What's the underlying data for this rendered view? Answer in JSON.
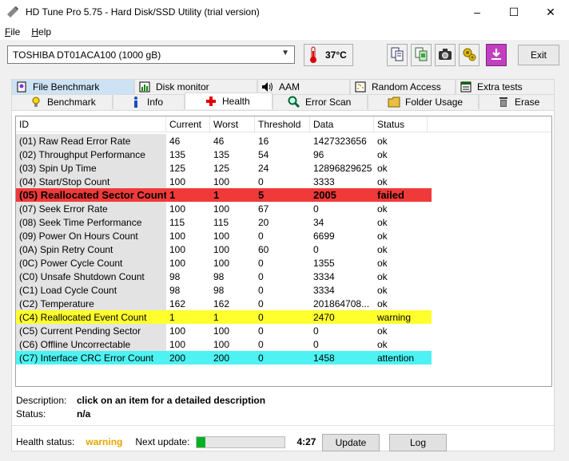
{
  "window": {
    "title": "HD Tune Pro 5.75 - Hard Disk/SSD Utility (trial version)",
    "minimize": "–",
    "maximize": "☐",
    "close": "✕"
  },
  "menu": [
    {
      "accel": "F",
      "rest": "ile"
    },
    {
      "accel": "H",
      "rest": "elp"
    }
  ],
  "toolbar": {
    "drive": "TOSHIBA DT01ACA100 (1000 gB)",
    "temperature": "37°C",
    "exit_label": "Exit",
    "icons": [
      "copy-text-icon",
      "copy-screen-icon",
      "camera-icon",
      "options-icon",
      "save-icon"
    ]
  },
  "tabs_row1": [
    {
      "label": "File Benchmark",
      "icon": "file-benchmark-icon"
    },
    {
      "label": "Disk monitor",
      "icon": "disk-monitor-icon"
    },
    {
      "label": "AAM",
      "icon": "speaker-icon"
    },
    {
      "label": "Random Access",
      "icon": "random-access-icon"
    },
    {
      "label": "Extra tests",
      "icon": "extra-tests-icon"
    }
  ],
  "tabs_row2": [
    {
      "label": "Benchmark",
      "icon": "benchmark-icon"
    },
    {
      "label": "Info",
      "icon": "info-icon"
    },
    {
      "label": "Health",
      "icon": "health-icon"
    },
    {
      "label": "Error Scan",
      "icon": "error-scan-icon"
    },
    {
      "label": "Folder Usage",
      "icon": "folder-icon"
    },
    {
      "label": "Erase",
      "icon": "erase-icon"
    }
  ],
  "table": {
    "headers": [
      "ID",
      "Current",
      "Worst",
      "Threshold",
      "Data",
      "Status"
    ],
    "rows": [
      {
        "id": "(01) Raw Read Error Rate",
        "current": "46",
        "worst": "46",
        "threshold": "16",
        "data": "1427323656",
        "status": "ok",
        "kind": "normal"
      },
      {
        "id": "(02) Throughput Performance",
        "current": "135",
        "worst": "135",
        "threshold": "54",
        "data": "96",
        "status": "ok",
        "kind": "normal"
      },
      {
        "id": "(03) Spin Up Time",
        "current": "125",
        "worst": "125",
        "threshold": "24",
        "data": "12896829625",
        "status": "ok",
        "kind": "normal"
      },
      {
        "id": "(04) Start/Stop Count",
        "current": "100",
        "worst": "100",
        "threshold": "0",
        "data": "3333",
        "status": "ok",
        "kind": "normal"
      },
      {
        "id": "(05) Reallocated Sector Count",
        "current": "1",
        "worst": "1",
        "threshold": "5",
        "data": "2005",
        "status": "failed",
        "kind": "failed"
      },
      {
        "id": "(07) Seek Error Rate",
        "current": "100",
        "worst": "100",
        "threshold": "67",
        "data": "0",
        "status": "ok",
        "kind": "normal"
      },
      {
        "id": "(08) Seek Time Performance",
        "current": "115",
        "worst": "115",
        "threshold": "20",
        "data": "34",
        "status": "ok",
        "kind": "normal"
      },
      {
        "id": "(09) Power On Hours Count",
        "current": "100",
        "worst": "100",
        "threshold": "0",
        "data": "6699",
        "status": "ok",
        "kind": "normal"
      },
      {
        "id": "(0A) Spin Retry Count",
        "current": "100",
        "worst": "100",
        "threshold": "60",
        "data": "0",
        "status": "ok",
        "kind": "normal"
      },
      {
        "id": "(0C) Power Cycle Count",
        "current": "100",
        "worst": "100",
        "threshold": "0",
        "data": "1355",
        "status": "ok",
        "kind": "normal"
      },
      {
        "id": "(C0) Unsafe Shutdown Count",
        "current": "98",
        "worst": "98",
        "threshold": "0",
        "data": "3334",
        "status": "ok",
        "kind": "normal"
      },
      {
        "id": "(C1) Load Cycle Count",
        "current": "98",
        "worst": "98",
        "threshold": "0",
        "data": "3334",
        "status": "ok",
        "kind": "normal"
      },
      {
        "id": "(C2) Temperature",
        "current": "162",
        "worst": "162",
        "threshold": "0",
        "data": "201864708...",
        "status": "ok",
        "kind": "normal"
      },
      {
        "id": "(C4) Reallocated Event Count",
        "current": "1",
        "worst": "1",
        "threshold": "0",
        "data": "2470",
        "status": "warning",
        "kind": "warning"
      },
      {
        "id": "(C5) Current Pending Sector",
        "current": "100",
        "worst": "100",
        "threshold": "0",
        "data": "0",
        "status": "ok",
        "kind": "normal"
      },
      {
        "id": "(C6) Offline Uncorrectable",
        "current": "100",
        "worst": "100",
        "threshold": "0",
        "data": "0",
        "status": "ok",
        "kind": "normal"
      },
      {
        "id": "(C7) Interface CRC Error Count",
        "current": "200",
        "worst": "200",
        "threshold": "0",
        "data": "1458",
        "status": "attention",
        "kind": "attention"
      }
    ]
  },
  "description": {
    "desc_label": "Description:",
    "desc_value": "click on an item for a detailed description",
    "status_label": "Status:",
    "status_value": "n/a"
  },
  "status_bar": {
    "health_label": "Health status:",
    "health_value": "warning",
    "next_label": "Next update:",
    "progress_fraction": 0.1,
    "countdown": "4:27",
    "update_button": "Update",
    "log_button": "Log"
  }
}
